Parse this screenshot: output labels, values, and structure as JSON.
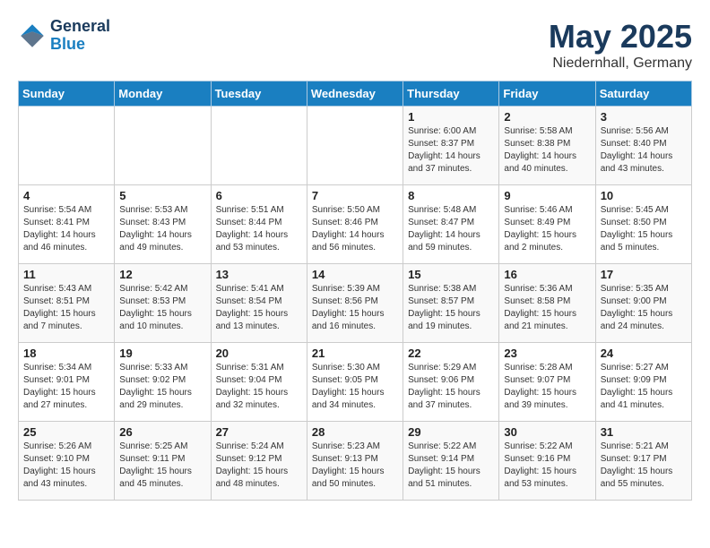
{
  "header": {
    "logo_line1": "General",
    "logo_line2": "Blue",
    "month_year": "May 2025",
    "location": "Niedernhall, Germany"
  },
  "days_of_week": [
    "Sunday",
    "Monday",
    "Tuesday",
    "Wednesday",
    "Thursday",
    "Friday",
    "Saturday"
  ],
  "weeks": [
    [
      {
        "day": "",
        "info": ""
      },
      {
        "day": "",
        "info": ""
      },
      {
        "day": "",
        "info": ""
      },
      {
        "day": "",
        "info": ""
      },
      {
        "day": "1",
        "info": "Sunrise: 6:00 AM\nSunset: 8:37 PM\nDaylight: 14 hours\nand 37 minutes."
      },
      {
        "day": "2",
        "info": "Sunrise: 5:58 AM\nSunset: 8:38 PM\nDaylight: 14 hours\nand 40 minutes."
      },
      {
        "day": "3",
        "info": "Sunrise: 5:56 AM\nSunset: 8:40 PM\nDaylight: 14 hours\nand 43 minutes."
      }
    ],
    [
      {
        "day": "4",
        "info": "Sunrise: 5:54 AM\nSunset: 8:41 PM\nDaylight: 14 hours\nand 46 minutes."
      },
      {
        "day": "5",
        "info": "Sunrise: 5:53 AM\nSunset: 8:43 PM\nDaylight: 14 hours\nand 49 minutes."
      },
      {
        "day": "6",
        "info": "Sunrise: 5:51 AM\nSunset: 8:44 PM\nDaylight: 14 hours\nand 53 minutes."
      },
      {
        "day": "7",
        "info": "Sunrise: 5:50 AM\nSunset: 8:46 PM\nDaylight: 14 hours\nand 56 minutes."
      },
      {
        "day": "8",
        "info": "Sunrise: 5:48 AM\nSunset: 8:47 PM\nDaylight: 14 hours\nand 59 minutes."
      },
      {
        "day": "9",
        "info": "Sunrise: 5:46 AM\nSunset: 8:49 PM\nDaylight: 15 hours\nand 2 minutes."
      },
      {
        "day": "10",
        "info": "Sunrise: 5:45 AM\nSunset: 8:50 PM\nDaylight: 15 hours\nand 5 minutes."
      }
    ],
    [
      {
        "day": "11",
        "info": "Sunrise: 5:43 AM\nSunset: 8:51 PM\nDaylight: 15 hours\nand 7 minutes."
      },
      {
        "day": "12",
        "info": "Sunrise: 5:42 AM\nSunset: 8:53 PM\nDaylight: 15 hours\nand 10 minutes."
      },
      {
        "day": "13",
        "info": "Sunrise: 5:41 AM\nSunset: 8:54 PM\nDaylight: 15 hours\nand 13 minutes."
      },
      {
        "day": "14",
        "info": "Sunrise: 5:39 AM\nSunset: 8:56 PM\nDaylight: 15 hours\nand 16 minutes."
      },
      {
        "day": "15",
        "info": "Sunrise: 5:38 AM\nSunset: 8:57 PM\nDaylight: 15 hours\nand 19 minutes."
      },
      {
        "day": "16",
        "info": "Sunrise: 5:36 AM\nSunset: 8:58 PM\nDaylight: 15 hours\nand 21 minutes."
      },
      {
        "day": "17",
        "info": "Sunrise: 5:35 AM\nSunset: 9:00 PM\nDaylight: 15 hours\nand 24 minutes."
      }
    ],
    [
      {
        "day": "18",
        "info": "Sunrise: 5:34 AM\nSunset: 9:01 PM\nDaylight: 15 hours\nand 27 minutes."
      },
      {
        "day": "19",
        "info": "Sunrise: 5:33 AM\nSunset: 9:02 PM\nDaylight: 15 hours\nand 29 minutes."
      },
      {
        "day": "20",
        "info": "Sunrise: 5:31 AM\nSunset: 9:04 PM\nDaylight: 15 hours\nand 32 minutes."
      },
      {
        "day": "21",
        "info": "Sunrise: 5:30 AM\nSunset: 9:05 PM\nDaylight: 15 hours\nand 34 minutes."
      },
      {
        "day": "22",
        "info": "Sunrise: 5:29 AM\nSunset: 9:06 PM\nDaylight: 15 hours\nand 37 minutes."
      },
      {
        "day": "23",
        "info": "Sunrise: 5:28 AM\nSunset: 9:07 PM\nDaylight: 15 hours\nand 39 minutes."
      },
      {
        "day": "24",
        "info": "Sunrise: 5:27 AM\nSunset: 9:09 PM\nDaylight: 15 hours\nand 41 minutes."
      }
    ],
    [
      {
        "day": "25",
        "info": "Sunrise: 5:26 AM\nSunset: 9:10 PM\nDaylight: 15 hours\nand 43 minutes."
      },
      {
        "day": "26",
        "info": "Sunrise: 5:25 AM\nSunset: 9:11 PM\nDaylight: 15 hours\nand 45 minutes."
      },
      {
        "day": "27",
        "info": "Sunrise: 5:24 AM\nSunset: 9:12 PM\nDaylight: 15 hours\nand 48 minutes."
      },
      {
        "day": "28",
        "info": "Sunrise: 5:23 AM\nSunset: 9:13 PM\nDaylight: 15 hours\nand 50 minutes."
      },
      {
        "day": "29",
        "info": "Sunrise: 5:22 AM\nSunset: 9:14 PM\nDaylight: 15 hours\nand 51 minutes."
      },
      {
        "day": "30",
        "info": "Sunrise: 5:22 AM\nSunset: 9:16 PM\nDaylight: 15 hours\nand 53 minutes."
      },
      {
        "day": "31",
        "info": "Sunrise: 5:21 AM\nSunset: 9:17 PM\nDaylight: 15 hours\nand 55 minutes."
      }
    ]
  ]
}
